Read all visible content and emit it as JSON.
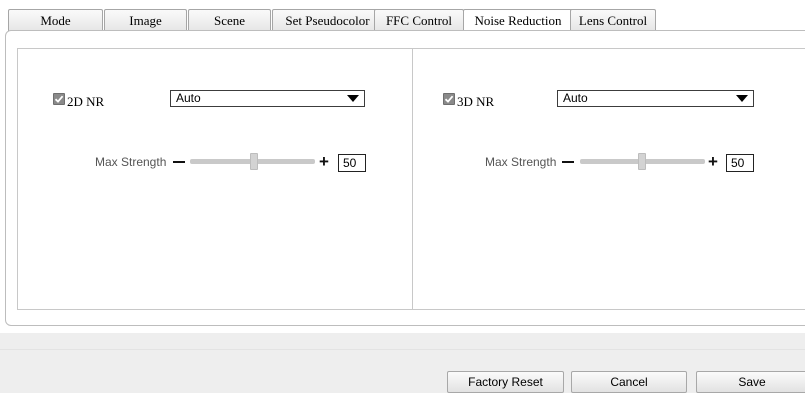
{
  "tabs": [
    {
      "label": "Mode"
    },
    {
      "label": "Image"
    },
    {
      "label": "Scene"
    },
    {
      "label": "Set Pseudocolor"
    },
    {
      "label": "FFC Control"
    },
    {
      "label": "Noise Reduction",
      "active": true
    },
    {
      "label": "Lens Control"
    }
  ],
  "nr2d": {
    "label": "2D NR",
    "checked": true,
    "mode": "Auto",
    "strength_label": "Max Strength",
    "strength_value": "50",
    "strength_fraction": 0.5
  },
  "nr3d": {
    "label": "3D NR",
    "checked": true,
    "mode": "Auto",
    "strength_label": "Max Strength",
    "strength_value": "50",
    "strength_fraction": 0.5
  },
  "buttons": {
    "factory_reset": "Factory Reset",
    "cancel": "Cancel",
    "save": "Save"
  },
  "icons": {
    "checkmark": "checkmark-icon",
    "dropdown": "chevron-down-icon",
    "minus": "minus-icon",
    "plus": "plus-icon"
  }
}
